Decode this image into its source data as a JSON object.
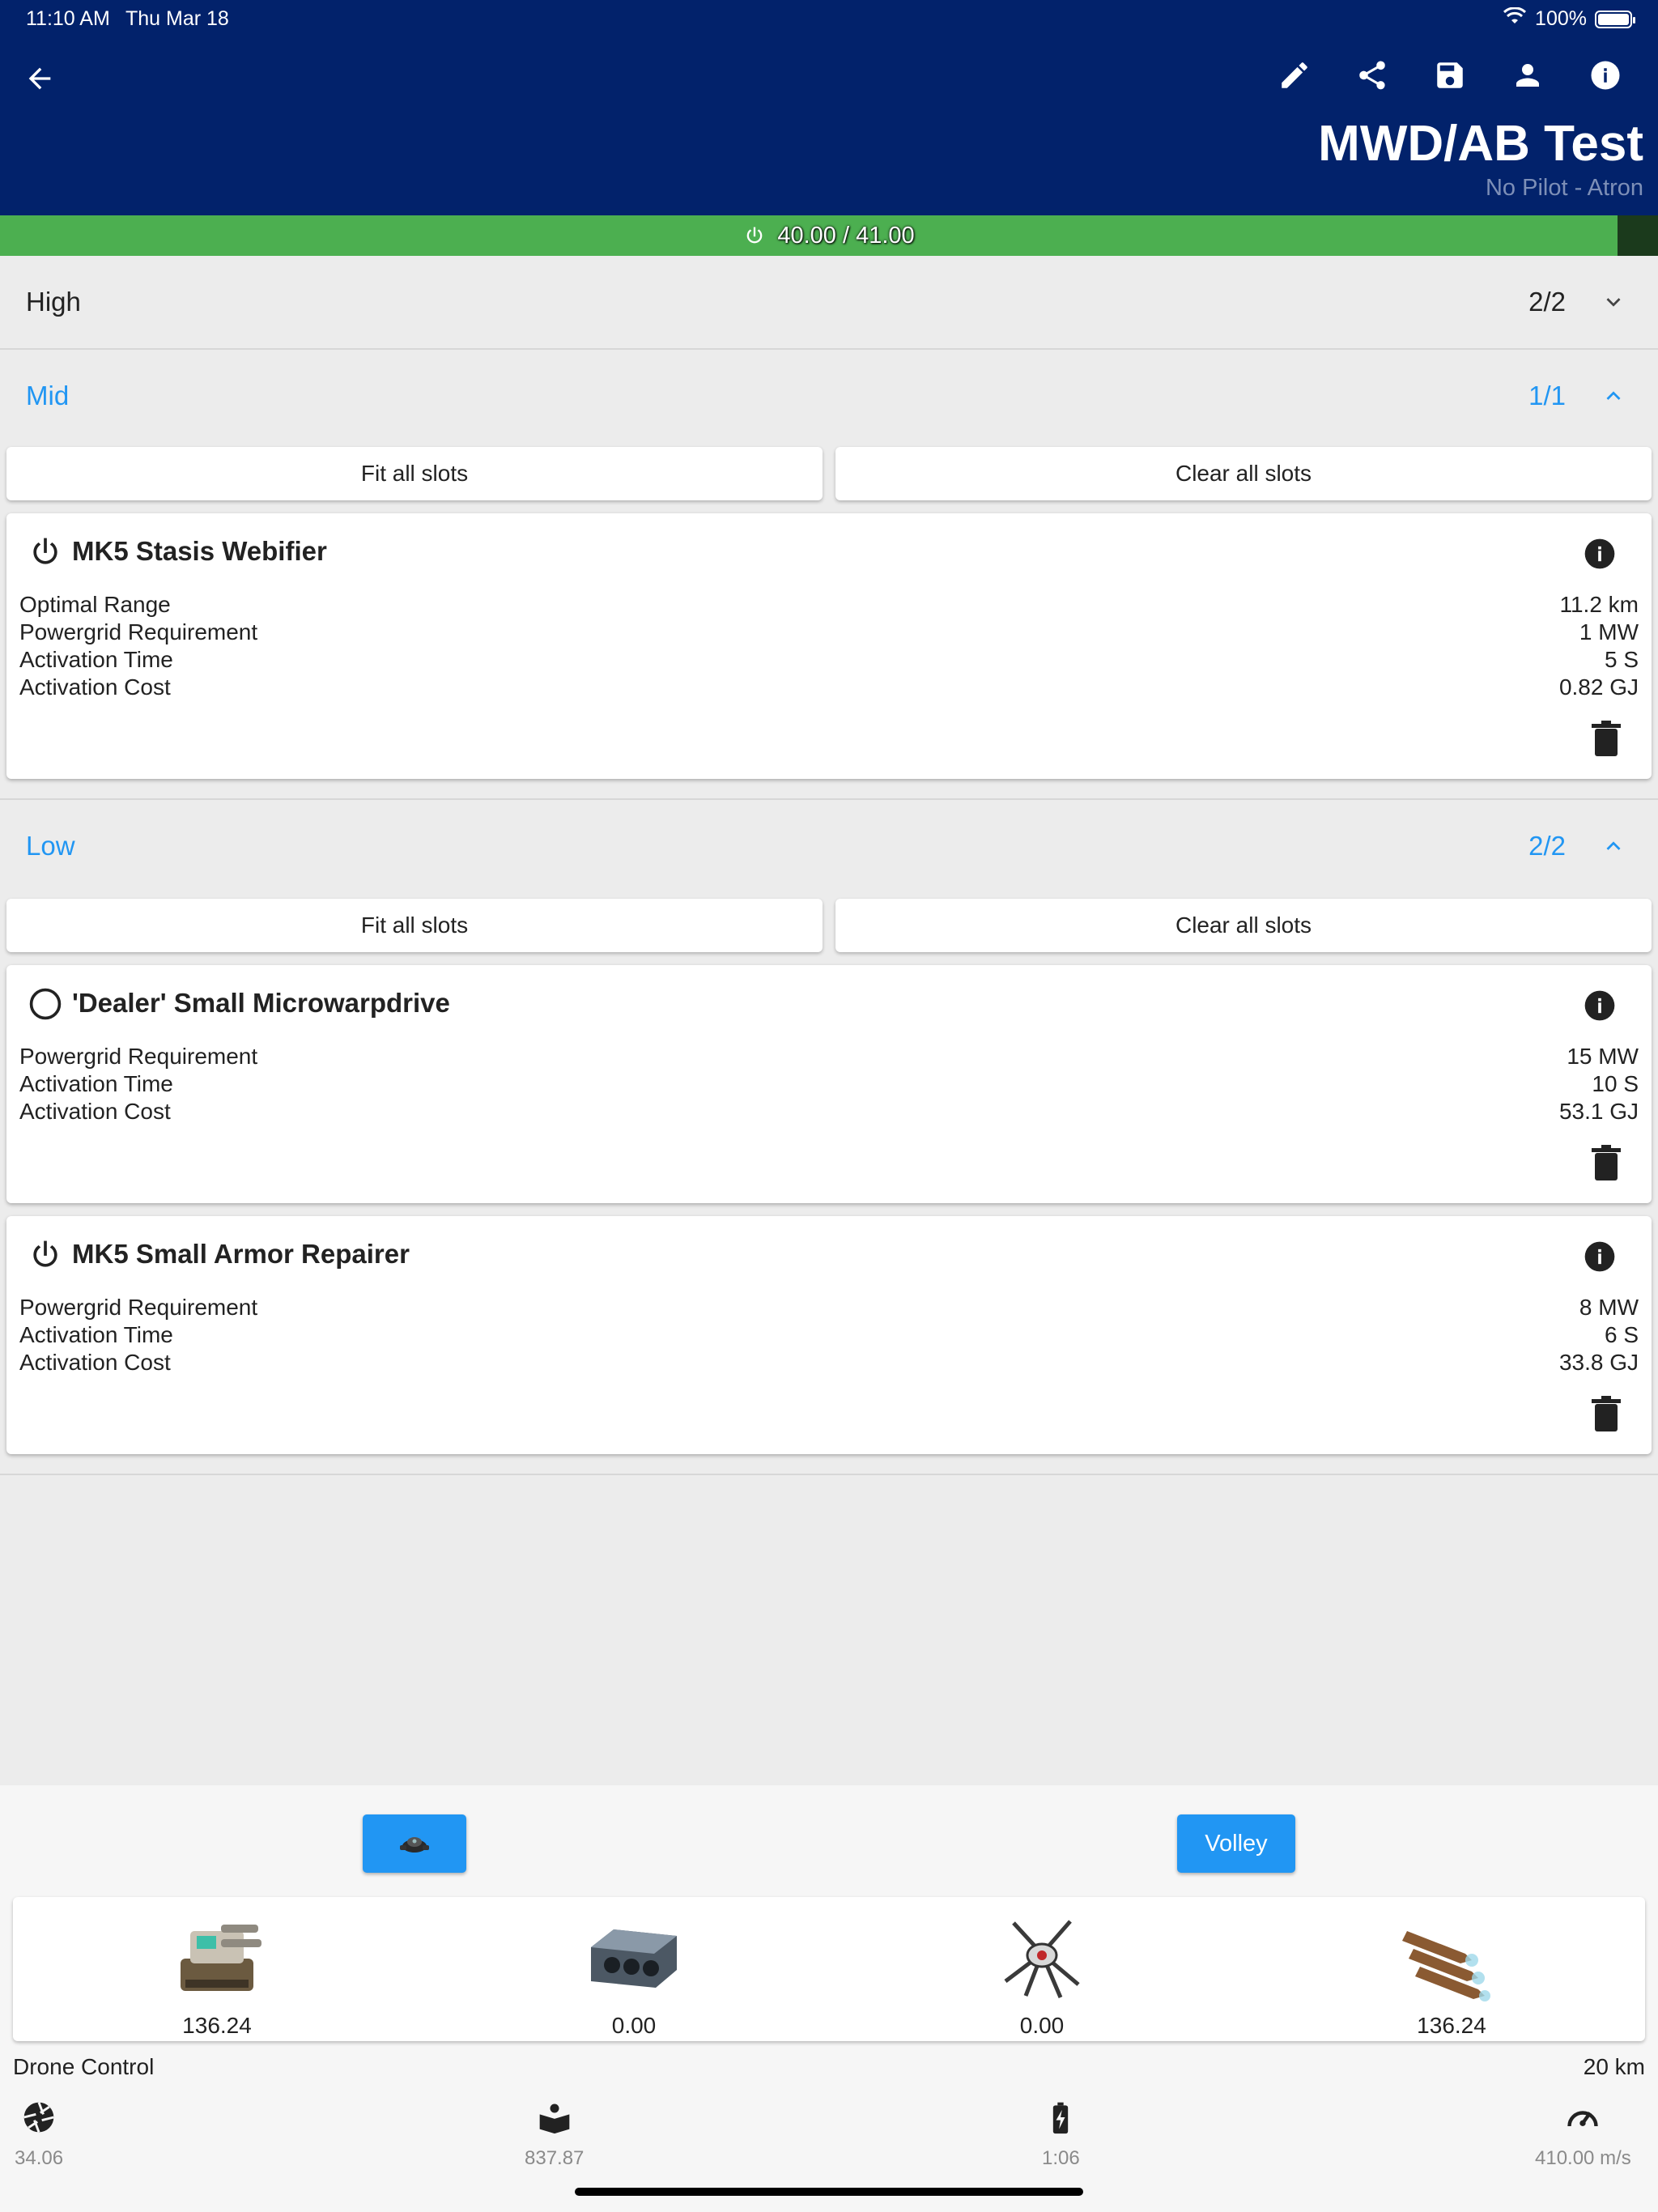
{
  "status_bar": {
    "time": "11:10 AM",
    "date": "Thu Mar 18",
    "battery": "100%"
  },
  "header": {
    "title": "MWD/AB Test",
    "subtitle": "No Pilot - Atron",
    "toolbar_icons": [
      "edit-icon",
      "share-icon",
      "save-icon",
      "pilot-icon",
      "info-icon"
    ]
  },
  "powergrid": {
    "text": "40.00 / 41.00",
    "used": 40.0,
    "total": 41.0,
    "fraction": 0.9756
  },
  "sections": {
    "high": {
      "label": "High",
      "count": "2/2",
      "expanded": false
    },
    "mid": {
      "label": "Mid",
      "count": "1/1",
      "expanded": true,
      "fit_all": "Fit all slots",
      "clear_all": "Clear all slots"
    },
    "low": {
      "label": "Low",
      "count": "2/2",
      "expanded": true,
      "fit_all": "Fit all slots",
      "clear_all": "Clear all slots"
    }
  },
  "modules": [
    {
      "name": "MK5 Stasis Webifier",
      "state": "active",
      "stats": [
        {
          "label": "Optimal Range",
          "value": "11.2 km"
        },
        {
          "label": "Powergrid Requirement",
          "value": "1 MW"
        },
        {
          "label": "Activation Time",
          "value": "5 S"
        },
        {
          "label": "Activation Cost",
          "value": "0.82 GJ"
        }
      ]
    },
    {
      "name": "'Dealer' Small Microwarpdrive",
      "state": "offline",
      "stats": [
        {
          "label": "Powergrid Requirement",
          "value": "15 MW"
        },
        {
          "label": "Activation Time",
          "value": "10 S"
        },
        {
          "label": "Activation Cost",
          "value": "53.1 GJ"
        }
      ]
    },
    {
      "name": "MK5 Small Armor Repairer",
      "state": "active",
      "stats": [
        {
          "label": "Powergrid Requirement",
          "value": "8 MW"
        },
        {
          "label": "Activation Time",
          "value": "6 S"
        },
        {
          "label": "Activation Cost",
          "value": "33.8 GJ"
        }
      ]
    }
  ],
  "bottom": {
    "drone_button_icon": "drone-icon",
    "volley_label": "Volley",
    "damage": [
      {
        "icon": "turret-icon",
        "value": "136.24"
      },
      {
        "icon": "missile-launcher-icon",
        "value": "0.00"
      },
      {
        "icon": "drone-bay-icon",
        "value": "0.00"
      },
      {
        "icon": "missiles-icon",
        "value": "136.24"
      }
    ],
    "drone_control_label": "Drone Control",
    "drone_control_range": "20 km",
    "stats": [
      {
        "icon": "aperture-icon",
        "value": "34.06"
      },
      {
        "icon": "cargo-icon",
        "value": "837.87"
      },
      {
        "icon": "capacitor-icon",
        "value": "1:06"
      },
      {
        "icon": "speedometer-icon",
        "value": "410.00 m/s"
      }
    ]
  },
  "colors": {
    "header_bg": "#02226b",
    "accent": "#2196f3",
    "powergrid_fill": "#4caf50",
    "powergrid_remaining": "#1b3a1c"
  }
}
